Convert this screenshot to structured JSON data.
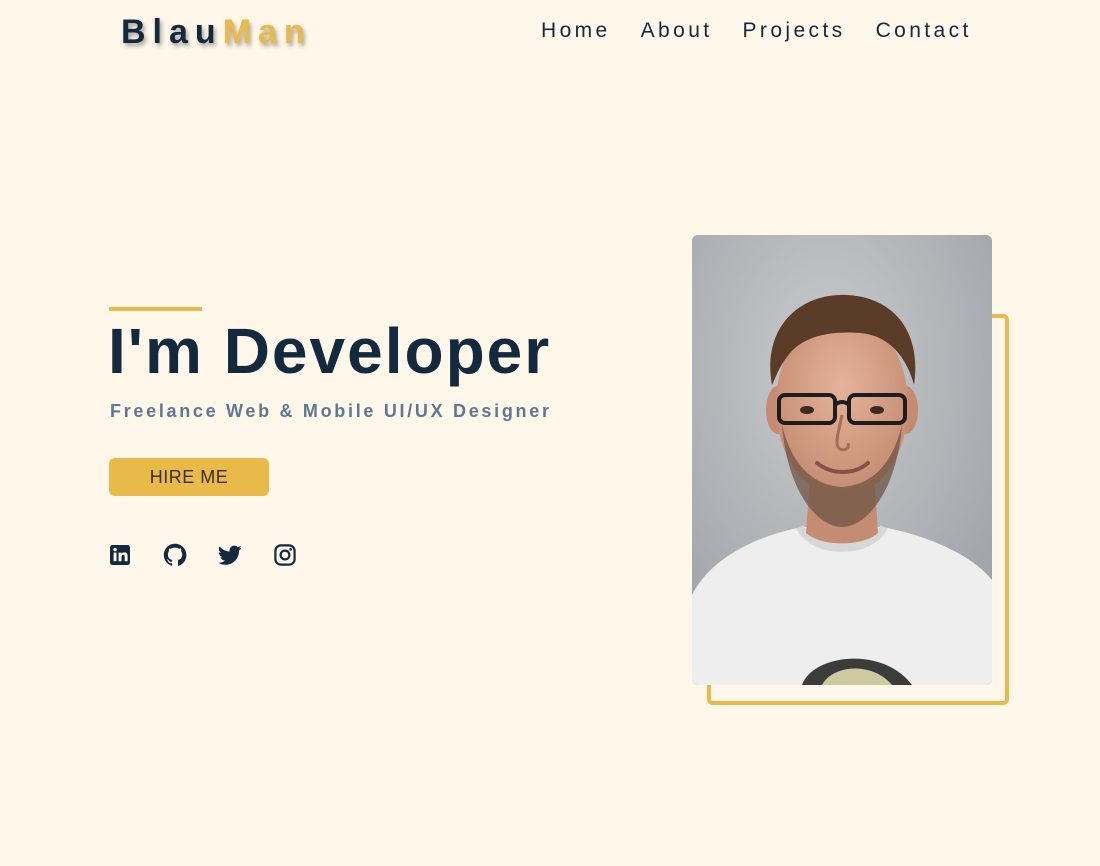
{
  "header": {
    "logo_part_a": "Blau",
    "logo_part_b": "Man",
    "nav": [
      {
        "label": "Home"
      },
      {
        "label": "About"
      },
      {
        "label": "Projects"
      },
      {
        "label": "Contact"
      }
    ]
  },
  "hero": {
    "title": "I'm Developer",
    "subtitle": "Freelance Web & Mobile UI/UX Designer",
    "cta_label": "HIRE ME",
    "socials": [
      {
        "icon": "linkedin-icon"
      },
      {
        "icon": "github-icon"
      },
      {
        "icon": "twitter-icon"
      },
      {
        "icon": "instagram-icon"
      }
    ]
  },
  "colors": {
    "background": "#fff8ea",
    "navy": "#13293d",
    "accent": "#e9b949",
    "muted": "#5c7893"
  }
}
